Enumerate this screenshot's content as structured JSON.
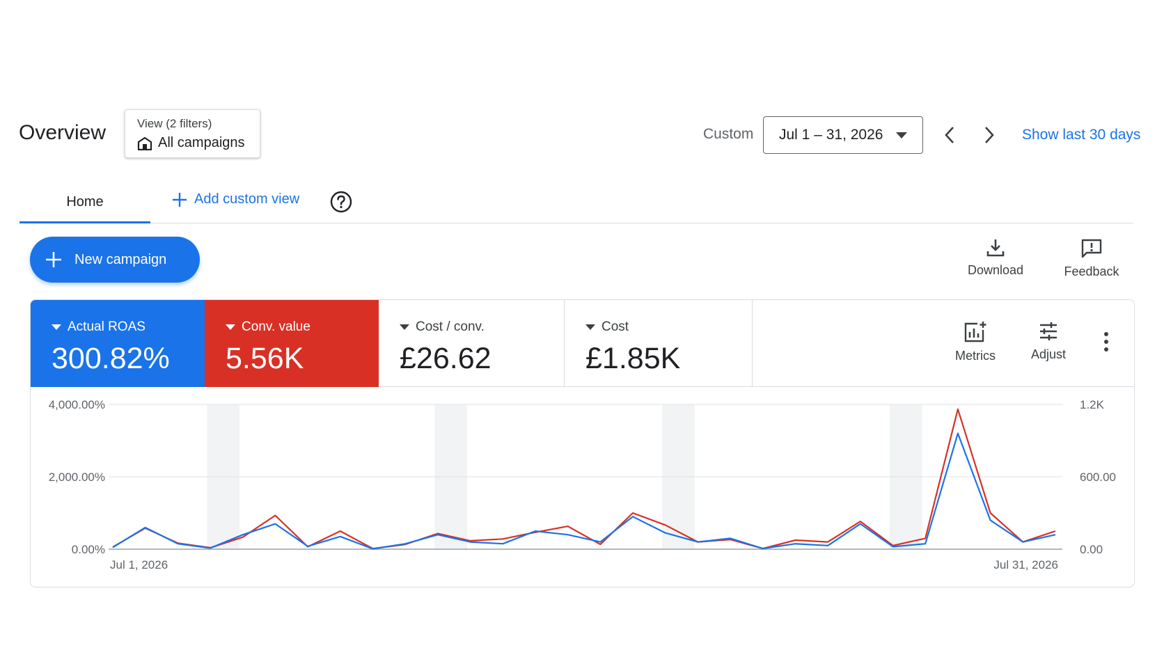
{
  "header": {
    "title": "Overview",
    "view_label": "View (2 filters)",
    "view_value": "All campaigns",
    "date_prefix": "Custom",
    "date_range": "Jul 1 – 31, 2026",
    "show_last": "Show last 30 days"
  },
  "tabs": {
    "home": "Home",
    "add_custom_view": "Add custom view"
  },
  "actions": {
    "new_campaign": "New campaign",
    "download": "Download",
    "feedback": "Feedback",
    "metrics": "Metrics",
    "adjust": "Adjust"
  },
  "metrics": [
    {
      "label": "Actual ROAS",
      "value": "300.82%",
      "color": "#1a73e8"
    },
    {
      "label": "Conv. value",
      "value": "5.56K",
      "color": "#d93025"
    },
    {
      "label": "Cost / conv.",
      "value": "£26.62"
    },
    {
      "label": "Cost",
      "value": "£1.85K"
    }
  ],
  "chart_data": {
    "type": "line",
    "x": [
      "Jul 1, 2026",
      "Jul 2, 2026",
      "Jul 3, 2026",
      "Jul 4, 2026",
      "Jul 5, 2026",
      "Jul 6, 2026",
      "Jul 7, 2026",
      "Jul 8, 2026",
      "Jul 9, 2026",
      "Jul 10, 2026",
      "Jul 11, 2026",
      "Jul 12, 2026",
      "Jul 13, 2026",
      "Jul 14, 2026",
      "Jul 15, 2026",
      "Jul 16, 2026",
      "Jul 17, 2026",
      "Jul 18, 2026",
      "Jul 19, 2026",
      "Jul 20, 2026",
      "Jul 21, 2026",
      "Jul 22, 2026",
      "Jul 23, 2026",
      "Jul 24, 2026",
      "Jul 25, 2026",
      "Jul 26, 2026",
      "Jul 27, 2026",
      "Jul 28, 2026",
      "Jul 29, 2026",
      "Jul 30, 2026",
      "Jul 31, 2026"
    ],
    "x_tick_labels": [
      "Jul 1, 2026",
      "Jul 31, 2026"
    ],
    "series": [
      {
        "name": "Actual ROAS",
        "axis": "left",
        "color": "#1a73e8",
        "values": [
          50,
          600,
          150,
          30,
          400,
          700,
          80,
          350,
          10,
          150,
          400,
          200,
          150,
          500,
          400,
          200,
          900,
          450,
          200,
          300,
          20,
          150,
          100,
          700,
          70,
          150,
          3200,
          800,
          200,
          400
        ]
      },
      {
        "name": "Conv. value",
        "axis": "right",
        "color": "#d93025",
        "values": [
          18,
          175,
          50,
          12,
          100,
          280,
          20,
          150,
          5,
          40,
          130,
          70,
          85,
          140,
          190,
          40,
          300,
          200,
          60,
          80,
          5,
          75,
          60,
          230,
          30,
          90,
          1160,
          300,
          60,
          150
        ]
      }
    ],
    "y_left": {
      "ticks": [
        "0.00%",
        "2,000.00%",
        "4,000.00%"
      ],
      "range": [
        0,
        4000
      ]
    },
    "y_right": {
      "ticks": [
        "0.00",
        "600.00",
        "1.2K"
      ],
      "range": [
        0,
        1200
      ]
    },
    "weekend_shading": true
  }
}
